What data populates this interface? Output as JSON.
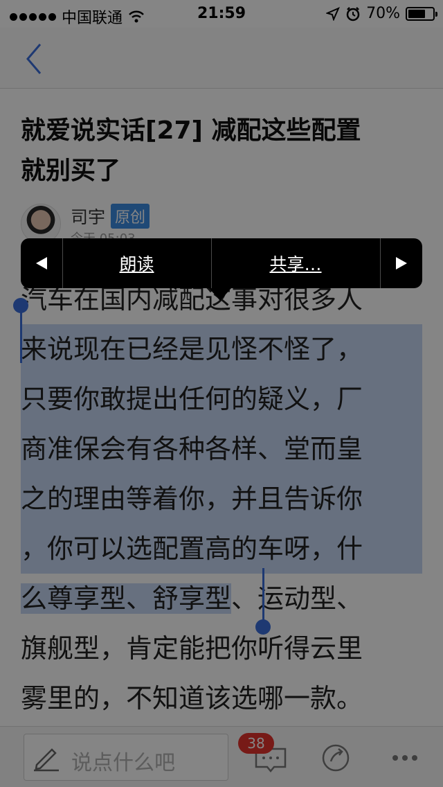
{
  "status_bar": {
    "carrier": "中国联通",
    "time": "21:59",
    "battery": "70%",
    "battery_level": 0.7,
    "icons": [
      "signal-icon",
      "wifi-icon",
      "location-arrow-icon",
      "alarm-icon",
      "battery-icon"
    ]
  },
  "nav": {
    "back_icon": "chevron-left-icon"
  },
  "article": {
    "title_line1": "就爱说实话[27] 减配这些配置",
    "title_line2": "就别买了",
    "author": "司宇",
    "badge": "原创",
    "date": "今天 05:03",
    "lines": [
      "汽车在国内减配这事对很多人",
      "来说现在已经是见怪不怪了，",
      "只要你敢提出任何的疑义，厂",
      "商准保会有各种各样、堂而皇",
      "之的理由等着你，并且告诉你",
      "，你可以选配置高的车呀，什",
      "么尊享型、舒享型",
      "旗舰型，肯定能把你听得云里",
      "雾里的，不知道该选哪一款。"
    ],
    "line7_rest": "、运动型、"
  },
  "callout": {
    "prev_icon": "triangle-left-icon",
    "read_label": "朗读",
    "share_label": "共享…",
    "next_icon": "triangle-right-icon"
  },
  "toolbar": {
    "comment_placeholder": "说点什么吧",
    "comment_count": "38",
    "icons": [
      "pencil-icon",
      "comment-icon",
      "share-icon",
      "more-icon"
    ]
  },
  "colors": {
    "selection": "#c5d7f3",
    "handle": "#3b6ddb",
    "badge": "#3d8de2",
    "count_badge": "#e5322d",
    "back_chevron": "#3b6ddb"
  }
}
